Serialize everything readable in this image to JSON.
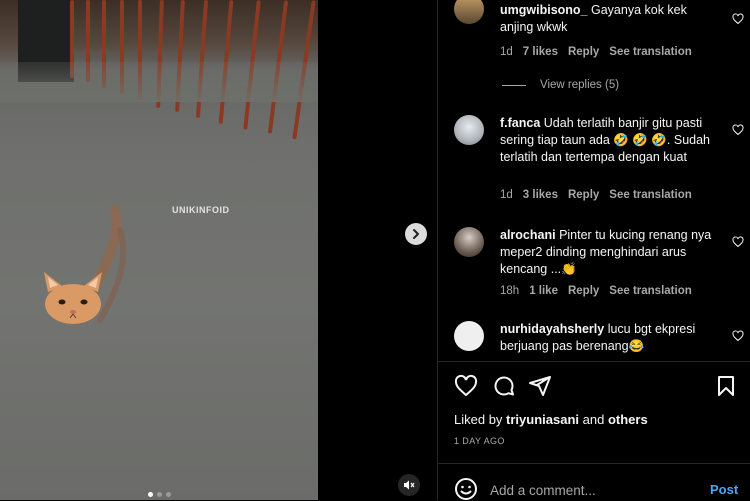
{
  "media": {
    "watermark": "UNIKINFOID",
    "carousel_dots": 3,
    "active_dot": 1
  },
  "comments": [
    {
      "username": "umgwibisono_",
      "text": "Gayanya kok kek anjing wkwk",
      "time": "1d",
      "likes": "7 likes",
      "reply_label": "Reply",
      "translate_label": "See translation",
      "view_replies": "View replies (5)"
    },
    {
      "username": "f.fanca",
      "text": "Udah terlatih banjir gitu pasti sering tiap taun ada 🤣 🤣 🤣. Sudah terlatih dan tertempa dengan kuat",
      "time": "1d",
      "likes": "3 likes",
      "reply_label": "Reply",
      "translate_label": "See translation"
    },
    {
      "username": "alrochani",
      "text": "Pinter tu kucing renang nya meper2 dinding menghindari arus kencang ...👏",
      "time": "18h",
      "likes": "1 like",
      "reply_label": "Reply",
      "translate_label": "See translation"
    },
    {
      "username": "nurhidayahsherly",
      "text": "lucu bgt ekpresi berjuang pas berenang😂"
    }
  ],
  "likes": {
    "prefix": "Liked by",
    "user": "triyuniasani",
    "conj": "and",
    "others": "others"
  },
  "date": "1 DAY AGO",
  "add_comment": {
    "placeholder": "Add a comment...",
    "post_label": "Post"
  },
  "icons": {
    "like": "heart-icon",
    "comment": "comment-icon",
    "share": "share-icon",
    "save": "bookmark-icon",
    "emoji": "emoji-icon",
    "next": "chevron-right-icon",
    "mute": "mute-icon"
  },
  "colors": {
    "accent": "#4ea4f6",
    "secondary_text": "#a8a8a8",
    "background": "#000000"
  }
}
